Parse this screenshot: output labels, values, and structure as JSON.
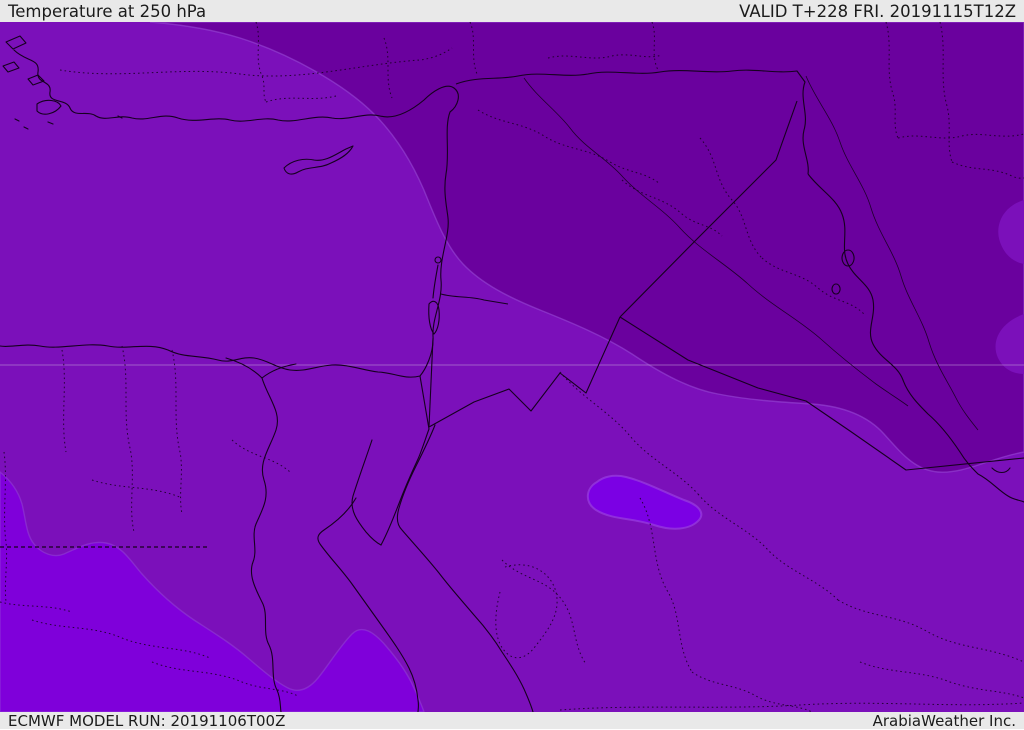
{
  "header": {
    "title": "Temperature at 250 hPa",
    "valid": "VALID T+228 FRI. 20191115T12Z"
  },
  "footer": {
    "model_run": "ECMWF MODEL RUN: 20191106T00Z",
    "credit": "ArabiaWeather Inc."
  },
  "map": {
    "colors": {
      "base_band": "#7b10ba",
      "dark_band": "#6a019e",
      "bright_band": "#7f00da",
      "brightest_blob": "#7b00e4",
      "band_rim": "#9a4fd8",
      "blob_rim": "#9a3fe0",
      "line": "#16001f",
      "gridline": "#c39ad8",
      "bar_bg": "#e9e9e9",
      "bar_text": "#1b1b1b"
    }
  }
}
